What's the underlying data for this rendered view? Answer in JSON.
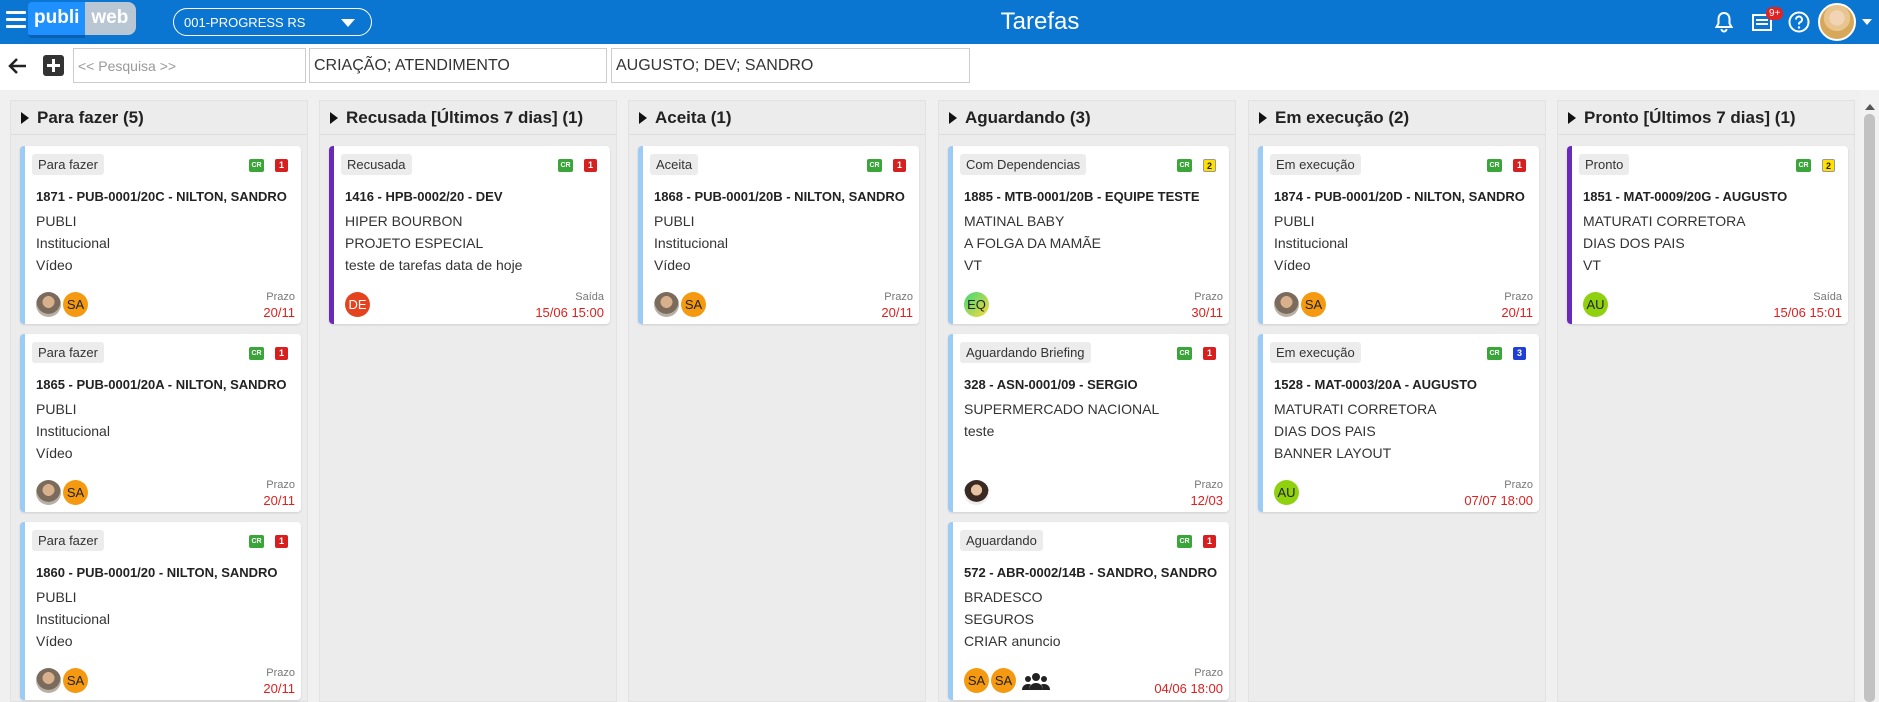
{
  "header": {
    "logo_left": "publi",
    "logo_right": "web",
    "company": "001-PROGRESS RS",
    "title": "Tarefas",
    "notif_count": "9+"
  },
  "filters": {
    "search_placeholder": "<< Pesquisa >>",
    "departments": "CRIAÇÃO; ATENDIMENTO",
    "users": "AUGUSTO; DEV; SANDRO"
  },
  "columns": [
    {
      "title": "Para fazer (5)",
      "cards": [
        {
          "status": "Para fazer",
          "cr": "CR",
          "num": "1",
          "title": "1871 - PUB-0001/20C - NILTON, SANDRO",
          "lines": [
            "PUBLI",
            "Institucional",
            "Vídeo"
          ],
          "avatars": [
            "",
            "SA"
          ],
          "date_label": "Prazo",
          "date": "20/11"
        },
        {
          "status": "Para fazer",
          "cr": "CR",
          "num": "1",
          "title": "1865 - PUB-0001/20A - NILTON, SANDRO",
          "lines": [
            "PUBLI",
            "Institucional",
            "Vídeo"
          ],
          "avatars": [
            "",
            "SA"
          ],
          "date_label": "Prazo",
          "date": "20/11"
        },
        {
          "status": "Para fazer",
          "cr": "CR",
          "num": "1",
          "title": "1860 - PUB-0001/20 - NILTON, SANDRO",
          "lines": [
            "PUBLI",
            "Institucional",
            "Vídeo"
          ],
          "avatars": [
            "",
            "SA"
          ],
          "date_label": "Prazo",
          "date": "20/11"
        }
      ]
    },
    {
      "title": "Recusada [Últimos 7 dias] (1)",
      "cards": [
        {
          "status": "Recusada",
          "cr": "CR",
          "num": "1",
          "title": "1416 - HPB-0002/20 - DEV",
          "lines": [
            "HIPER BOURBON",
            "PROJETO ESPECIAL",
            "teste de tarefas data de hoje"
          ],
          "avatars": [
            "DE"
          ],
          "date_label": "Saída",
          "date": "15/06 15:00"
        }
      ]
    },
    {
      "title": "Aceita (1)",
      "cards": [
        {
          "status": "Aceita",
          "cr": "CR",
          "num": "1",
          "title": "1868 - PUB-0001/20B - NILTON, SANDRO",
          "lines": [
            "PUBLI",
            "Institucional",
            "Vídeo"
          ],
          "avatars": [
            "",
            "SA"
          ],
          "date_label": "Prazo",
          "date": "20/11"
        }
      ]
    },
    {
      "title": "Aguardando (3)",
      "cards": [
        {
          "status": "Com Dependencias",
          "cr": "CR",
          "num": "2",
          "title": "1885 - MTB-0001/20B - EQUIPE TESTE",
          "lines": [
            "MATINAL BABY",
            "A FOLGA DA MAMÃE",
            "VT"
          ],
          "avatars": [
            "EQ"
          ],
          "date_label": "Prazo",
          "date": "30/11"
        },
        {
          "status": "Aguardando Briefing",
          "cr": "CR",
          "num": "1",
          "title": "328 - ASN-0001/09 - SERGIO",
          "lines": [
            "SUPERMERCADO NACIONAL",
            "teste",
            ""
          ],
          "avatars": [
            ""
          ],
          "date_label": "Prazo",
          "date": "12/03"
        },
        {
          "status": "Aguardando",
          "cr": "CR",
          "num": "1",
          "title": "572 - ABR-0002/14B - SANDRO, SANDRO",
          "lines": [
            "BRADESCO",
            "SEGUROS",
            "CRIAR anuncio"
          ],
          "avatars": [
            "SA",
            "SA"
          ],
          "date_label": "Prazo",
          "date": "04/06 18:00"
        }
      ]
    },
    {
      "title": "Em execução (2)",
      "cards": [
        {
          "status": "Em execução",
          "cr": "CR",
          "num": "1",
          "title": "1874 - PUB-0001/20D - NILTON, SANDRO",
          "lines": [
            "PUBLI",
            "Institucional",
            "Vídeo"
          ],
          "avatars": [
            "",
            "SA"
          ],
          "date_label": "Prazo",
          "date": "20/11"
        },
        {
          "status": "Em execução",
          "cr": "CR",
          "num": "3",
          "title": "1528 - MAT-0003/20A - AUGUSTO",
          "lines": [
            "MATURATI CORRETORA",
            "DIAS DOS PAIS",
            "BANNER LAYOUT"
          ],
          "avatars": [
            "AU"
          ],
          "date_label": "Prazo",
          "date": "07/07 18:00"
        }
      ]
    },
    {
      "title": "Pronto [Últimos 7 dias] (1)",
      "cards": [
        {
          "status": "Pronto",
          "cr": "CR",
          "num": "2",
          "title": "1851 - MAT-0009/20G - AUGUSTO",
          "lines": [
            "MATURATI CORRETORA",
            "DIAS DOS PAIS",
            "VT"
          ],
          "avatars": [
            "AU"
          ],
          "date_label": "Saída",
          "date": "15/06 15:01"
        }
      ]
    }
  ]
}
